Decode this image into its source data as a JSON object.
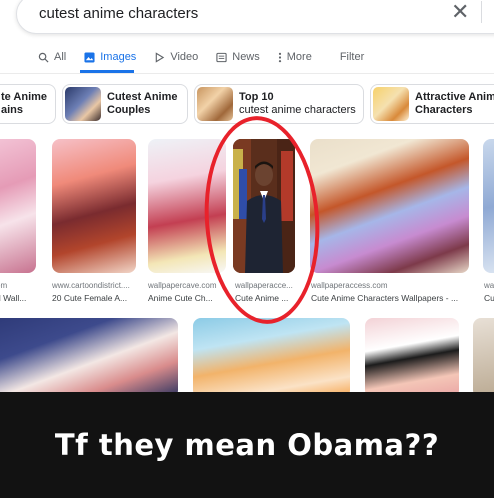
{
  "search": {
    "query": "cutest anime characters"
  },
  "tabs": [
    {
      "label": "All",
      "icon": "search-icon"
    },
    {
      "label": "Images",
      "icon": "image-icon",
      "active": true
    },
    {
      "label": "Video",
      "icon": "play-icon"
    },
    {
      "label": "News",
      "icon": "news-icon"
    },
    {
      "label": "More",
      "icon": "more-icon"
    },
    {
      "label": "Filter"
    }
  ],
  "chips": [
    {
      "title": "te Anime",
      "subtitle": "ains"
    },
    {
      "title": "Cutest Anime",
      "subtitle": "Couples"
    },
    {
      "title": "Top 10",
      "subtitle": "cutest anime characters"
    },
    {
      "title": "Attractive Anime",
      "subtitle": "Characters"
    }
  ],
  "results": [
    {
      "source": "om",
      "title": "rl Wall..."
    },
    {
      "source": "www.cartoondistrict....",
      "title": "20 Cute Female A..."
    },
    {
      "source": "wallpapercave.com",
      "title": "Anime Cute Ch..."
    },
    {
      "source": "wallpaperacce...",
      "title": "Cute Anime ..."
    },
    {
      "source": "wallpaperaccess.com",
      "title": "Cute Anime Characters Wallpapers - ..."
    },
    {
      "source": "wa",
      "title": "Cu"
    }
  ],
  "caption": "Tf they mean Obama??",
  "colors": {
    "accent": "#1a73e8",
    "annotation": "#e8222b",
    "band": "#121212"
  }
}
